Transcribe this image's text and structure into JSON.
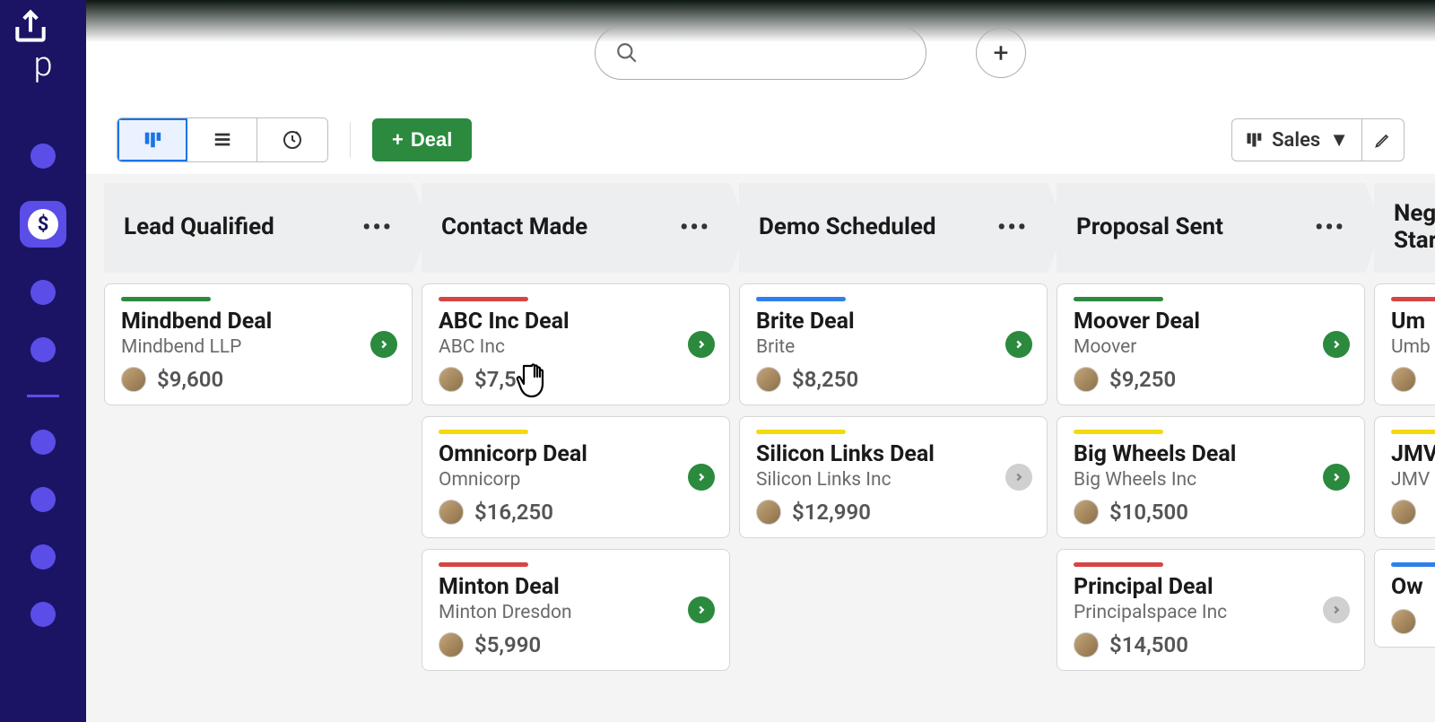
{
  "toolbar": {
    "new_deal_label": "Deal",
    "pipeline_selected": "Sales"
  },
  "columns": [
    {
      "title": "Lead Qualified",
      "cards": [
        {
          "status": "green",
          "title": "Mindbend Deal",
          "org": "Mindbend LLP",
          "value": "$9,600",
          "go": "green"
        }
      ]
    },
    {
      "title": "Contact Made",
      "cards": [
        {
          "status": "red",
          "title": "ABC Inc Deal",
          "org": "ABC Inc",
          "value": "$7,5",
          "go": "green"
        },
        {
          "status": "yellow",
          "title": "Omnicorp Deal",
          "org": "Omnicorp",
          "value": "$16,250",
          "go": "green"
        },
        {
          "status": "red",
          "title": "Minton Deal",
          "org": "Minton Dresdon",
          "value": "$5,990",
          "go": "green"
        }
      ]
    },
    {
      "title": "Demo Scheduled",
      "cards": [
        {
          "status": "blue",
          "title": "Brite Deal",
          "org": "Brite",
          "value": "$8,250",
          "go": "green"
        },
        {
          "status": "yellow",
          "title": "Silicon Links Deal",
          "org": "Silicon Links Inc",
          "value": "$12,990",
          "go": "grey"
        }
      ]
    },
    {
      "title": "Proposal Sent",
      "cards": [
        {
          "status": "green",
          "title": "Moover Deal",
          "org": "Moover",
          "value": "$9,250",
          "go": "green"
        },
        {
          "status": "yellow",
          "title": "Big Wheels Deal",
          "org": "Big Wheels Inc",
          "value": "$10,500",
          "go": "green"
        },
        {
          "status": "red",
          "title": "Principal Deal",
          "org": "Principalspace Inc",
          "value": "$14,500",
          "go": "grey"
        }
      ]
    },
    {
      "title": "Negotiations Started",
      "cards": [
        {
          "status": "red",
          "title": "Um",
          "org": "Umb",
          "value": "",
          "go": ""
        },
        {
          "status": "yellow",
          "title": "JMV",
          "org": "JMV",
          "value": "",
          "go": ""
        },
        {
          "status": "blue",
          "title": "Ow",
          "org": "",
          "value": "",
          "go": ""
        }
      ]
    }
  ]
}
